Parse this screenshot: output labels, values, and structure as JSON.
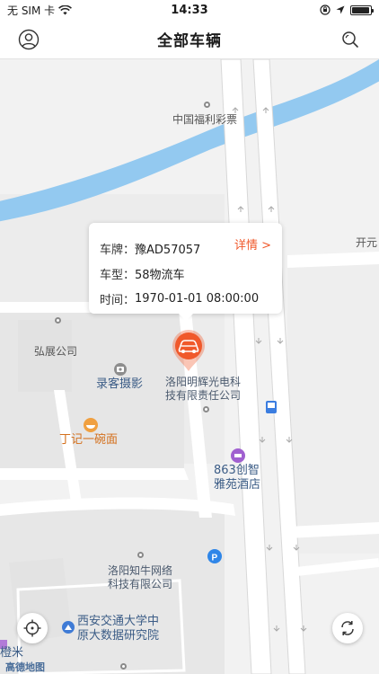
{
  "status": {
    "carrier": "无 SIM 卡",
    "time": "14:33",
    "battery_level": 0.95
  },
  "nav": {
    "title": "全部车辆",
    "left_icon": "person-icon",
    "right_icon": "search-icon"
  },
  "info_window": {
    "plate_label": "车牌：",
    "plate_value": "豫AD57057",
    "type_label": "车型：",
    "type_value": "58物流车",
    "time_label": "时间：",
    "time_value": "1970-01-01 08:00:00",
    "details_link": "详情 >"
  },
  "map": {
    "labels": {
      "lottery": "中国福利彩票",
      "kaiyuan": "开元",
      "hongzhan": "弘展公司",
      "luke": "录客摄影",
      "luoyang_minghui_1": "洛阳明辉光电科",
      "luoyang_minghui_2": "技有限责任公司",
      "dingji": "丁记一碗面",
      "hotel_1": "863创智",
      "hotel_2": "雅苑酒店",
      "zhiniu_1": "洛阳知牛网络",
      "zhiniu_2": "科技有限公司",
      "xjtu_1": "西安交通大学中",
      "xjtu_2": "原大数据研究院",
      "bottom_left": "橙米",
      "logo": "高德地图"
    },
    "water_color": "#93c9f0",
    "road_color": "#ffffff",
    "block_color": "#e9e9e9"
  },
  "marker": {
    "color": "#f0592b",
    "icon": "car-icon"
  },
  "buttons": {
    "locate_icon": "locate-icon",
    "refresh_icon": "refresh-icon"
  }
}
